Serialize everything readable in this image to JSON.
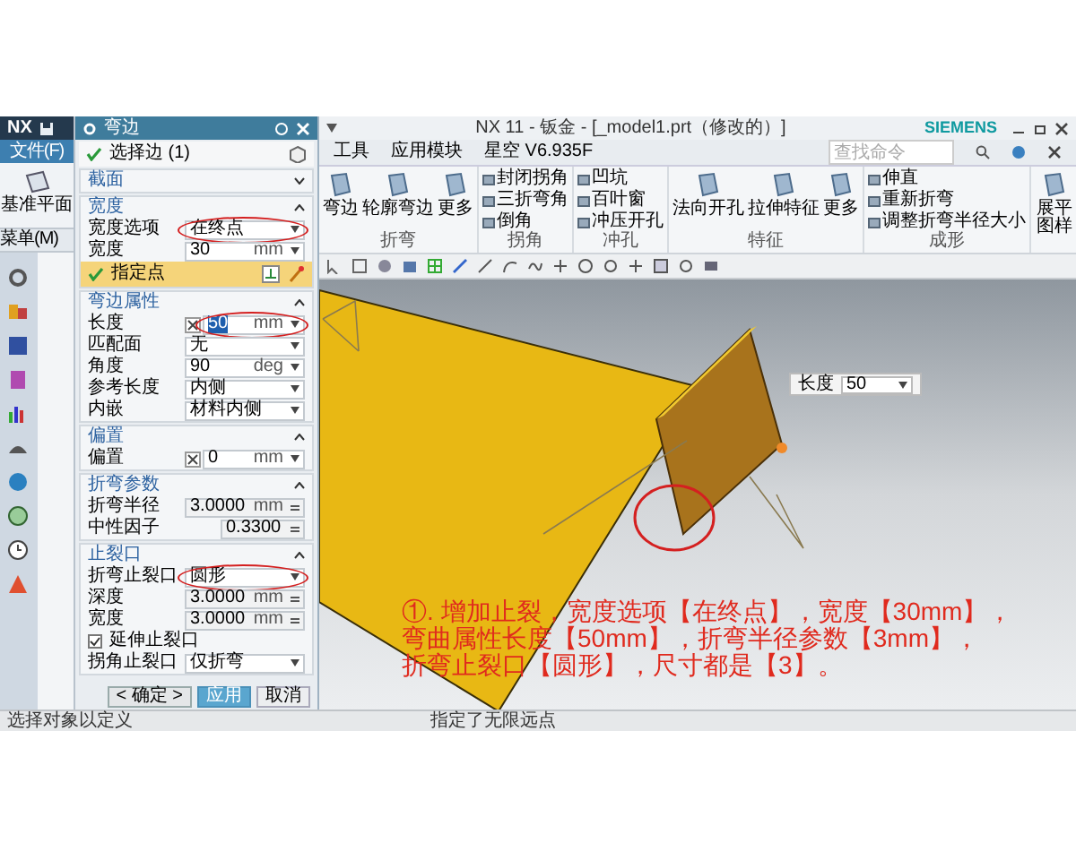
{
  "app_title": "NX 11 - 钣金 - [_model1.prt（修改的）]",
  "brand": "SIEMENS",
  "left_strip": {
    "logo": "NX",
    "file_button": "文件(F)",
    "datum_button": "基准平面",
    "menu_button": "菜单(M)"
  },
  "menu": [
    {
      "label": "工具"
    },
    {
      "label": "应用模块"
    },
    {
      "label": "星空 V6.935F"
    }
  ],
  "search": {
    "placeholder": "查找命令"
  },
  "ribbon": [
    {
      "label": "折弯",
      "items": [
        {
          "kind": "large",
          "label": "弯边"
        },
        {
          "kind": "large",
          "label": "轮廓弯边"
        },
        {
          "kind": "large",
          "label": "更多"
        }
      ]
    },
    {
      "label": "拐角",
      "items": [
        {
          "kind": "small",
          "label": "封闭拐角"
        },
        {
          "kind": "small",
          "label": "三折弯角"
        },
        {
          "kind": "small",
          "label": "倒角"
        }
      ]
    },
    {
      "label": "冲孔",
      "items": [
        {
          "kind": "small",
          "label": "凹坑"
        },
        {
          "kind": "small",
          "label": "百叶窗"
        },
        {
          "kind": "small",
          "label": "冲压开孔"
        }
      ]
    },
    {
      "label": "特征",
      "items": [
        {
          "kind": "large",
          "label": "法向开孔"
        },
        {
          "kind": "large",
          "label": "拉伸特征"
        },
        {
          "kind": "large",
          "label": "更多"
        }
      ]
    },
    {
      "label": "成形",
      "items": [
        {
          "kind": "small",
          "label": "伸直"
        },
        {
          "kind": "small",
          "label": "重新折弯"
        },
        {
          "kind": "small",
          "label": "调整折弯半径大小"
        }
      ]
    },
    {
      "items": [
        {
          "kind": "large",
          "label": "展平图样"
        }
      ]
    }
  ],
  "dialog": {
    "title": "弯边",
    "rows": [
      {
        "kind": "select",
        "label": "选择边 (1)"
      },
      {
        "kind": "section",
        "label": "截面",
        "expanded": false
      },
      {
        "kind": "section",
        "label": "宽度",
        "expanded": true
      },
      {
        "kind": "dropdown",
        "label": "宽度选项",
        "value": "在终点",
        "circled": true
      },
      {
        "kind": "unit",
        "label": "宽度",
        "value": "30",
        "unit": "mm",
        "circled": false
      },
      {
        "kind": "point",
        "label": "指定点"
      },
      {
        "kind": "section",
        "label": "弯边属性",
        "expanded": true
      },
      {
        "kind": "expr",
        "label": "长度",
        "value": "50",
        "unit": "mm",
        "circled": true
      },
      {
        "kind": "dropdown",
        "label": "匹配面",
        "value": "无",
        "circled": false
      },
      {
        "kind": "unit",
        "label": "角度",
        "value": "90",
        "unit": "deg",
        "circled": false
      },
      {
        "kind": "dropdown",
        "label": "参考长度",
        "value": "内侧",
        "circled": false
      },
      {
        "kind": "dropdown",
        "label": "内嵌",
        "value": "材料内侧",
        "circled": false
      },
      {
        "kind": "section",
        "label": "偏置",
        "expanded": true
      },
      {
        "kind": "expr",
        "label": "偏置",
        "value": "0",
        "unit": "mm",
        "circled": false
      },
      {
        "kind": "section",
        "label": "折弯参数",
        "expanded": true
      },
      {
        "kind": "locked",
        "label": "折弯半径",
        "value": "3.0000",
        "unit": "mm",
        "circled": false
      },
      {
        "kind": "locked",
        "label": "中性因子",
        "value": "0.3300",
        "circled": false
      },
      {
        "kind": "section",
        "label": "止裂口",
        "expanded": true
      },
      {
        "kind": "dropdown",
        "label": "折弯止裂口",
        "value": "圆形",
        "circled": true
      },
      {
        "kind": "locked",
        "label": "深度",
        "value": "3.0000",
        "unit": "mm",
        "circled": false
      },
      {
        "kind": "locked",
        "label": "宽度",
        "value": "3.0000",
        "unit": "mm",
        "circled": false
      },
      {
        "kind": "checkbox",
        "label": "延伸止裂口",
        "checked": true
      },
      {
        "kind": "dropdown",
        "label": "拐角止裂口",
        "value": "仅折弯",
        "circled": false
      }
    ],
    "buttons": [
      {
        "label": "< 确定 >",
        "kind": "default"
      },
      {
        "label": "应用",
        "kind": "primary"
      },
      {
        "label": "取消",
        "kind": "normal"
      }
    ]
  },
  "viewport": {
    "length_label": "长度",
    "length_value": "50",
    "circled": true,
    "annotation": [
      "①. 增加止裂，宽度选项【在终点】，宽度【30mm】，",
      "弯曲属性长度【50mm】，折弯半径参数【3mm】，",
      "折弯止裂口【圆形】，尺寸都是【3】。"
    ]
  },
  "status_bar": {
    "left": "选择对象以定义",
    "center": "指定了无限远点"
  }
}
